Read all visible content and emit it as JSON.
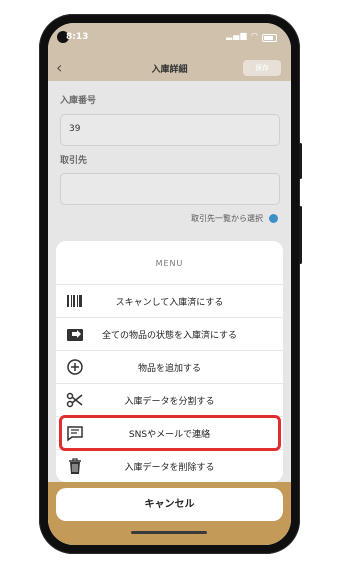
{
  "status_bar": {
    "time": "8:13"
  },
  "nav": {
    "back": "‹",
    "title": "入庫詳細",
    "save": "保存"
  },
  "form": {
    "number_label": "入庫番号",
    "number_value": "39",
    "supplier_label": "取引先",
    "supplier_value": "",
    "select_link": "取引先一覧から選択"
  },
  "menu": {
    "title": "MENU",
    "items": [
      {
        "label": "スキャンして入庫済にする",
        "icon": "barcode-icon"
      },
      {
        "label": "全ての物品の状態を入庫済にする",
        "icon": "box-arrow-icon"
      },
      {
        "label": "物品を追加する",
        "icon": "add-circle-icon"
      },
      {
        "label": "入庫データを分割する",
        "icon": "scissors-icon"
      },
      {
        "label": "SNSやメールで連絡",
        "icon": "message-icon"
      },
      {
        "label": "入庫データを削除する",
        "icon": "trash-icon"
      }
    ],
    "cancel": "キャンセル"
  },
  "colors": {
    "accent": "#c39a57",
    "header": "#cfc1ac",
    "highlight": "#e02e2e",
    "link": "#3d8fc8"
  }
}
